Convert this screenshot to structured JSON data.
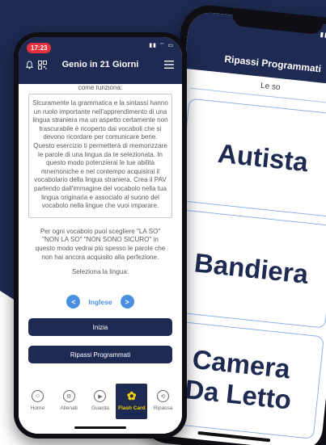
{
  "colors": {
    "navy": "#1e2a52",
    "accent_blue": "#4a90e2",
    "badge_red": "#e8313a",
    "highlight_yellow": "#f5d300"
  },
  "front": {
    "status_time": "17:23",
    "title": "Genio in 21 Giorni",
    "cut_off_heading": "come funziona:",
    "paragraph_1": "Sicuramente la grammatica e la sintassi hanno un ruolo importante nell'apprendimento di una lingua straniera ma un aspetto certamente non trascurabile è ricoperto dai vocaboli che si devono ricordare per comunicare bene. Questo esercizio ti permetterà di memorizzare le parole di una lingua da te selezionata. In questo modo potenzierai le tue abilità mnemoniche e nel contempo acquisirai il vocabolario della lingua straniera. Crea il PAV partendo dall'immagine del vocabolo nella tua lingua originaria e associalo al suono del vocabolo nella lingue che vuoi imparare.",
    "paragraph_2": "Per ogni vocabolo puoi scegliere \"LA SO\" \"NON LA SO\" \"NON SONO SICURO\" in questo modo vedrai più spesso le parole che non hai ancora acquisito alla perfezione.",
    "select_label": "Seleziona la lingua:",
    "language": "Inglese",
    "prev_arrow": "<",
    "next_arrow": ">",
    "start_button": "Inizia",
    "review_button": "Ripassi Programmati",
    "tabs": [
      {
        "label": "Home",
        "icon": "chef-hat-icon",
        "glyph": "☺"
      },
      {
        "label": "Allenati",
        "icon": "dumbbell-icon",
        "glyph": "⚙"
      },
      {
        "label": "Guarda",
        "icon": "play-icon",
        "glyph": "▶"
      },
      {
        "label": "Flash Card",
        "icon": "brain-icon",
        "glyph": "✿"
      },
      {
        "label": "Ripassa",
        "icon": "clock-icon",
        "glyph": "⟲"
      }
    ]
  },
  "back": {
    "title": "Ripassi Programmati",
    "subtitle": "Le so",
    "words": [
      "Autista",
      "Bandiera",
      "Camera\nDa Letto"
    ]
  }
}
